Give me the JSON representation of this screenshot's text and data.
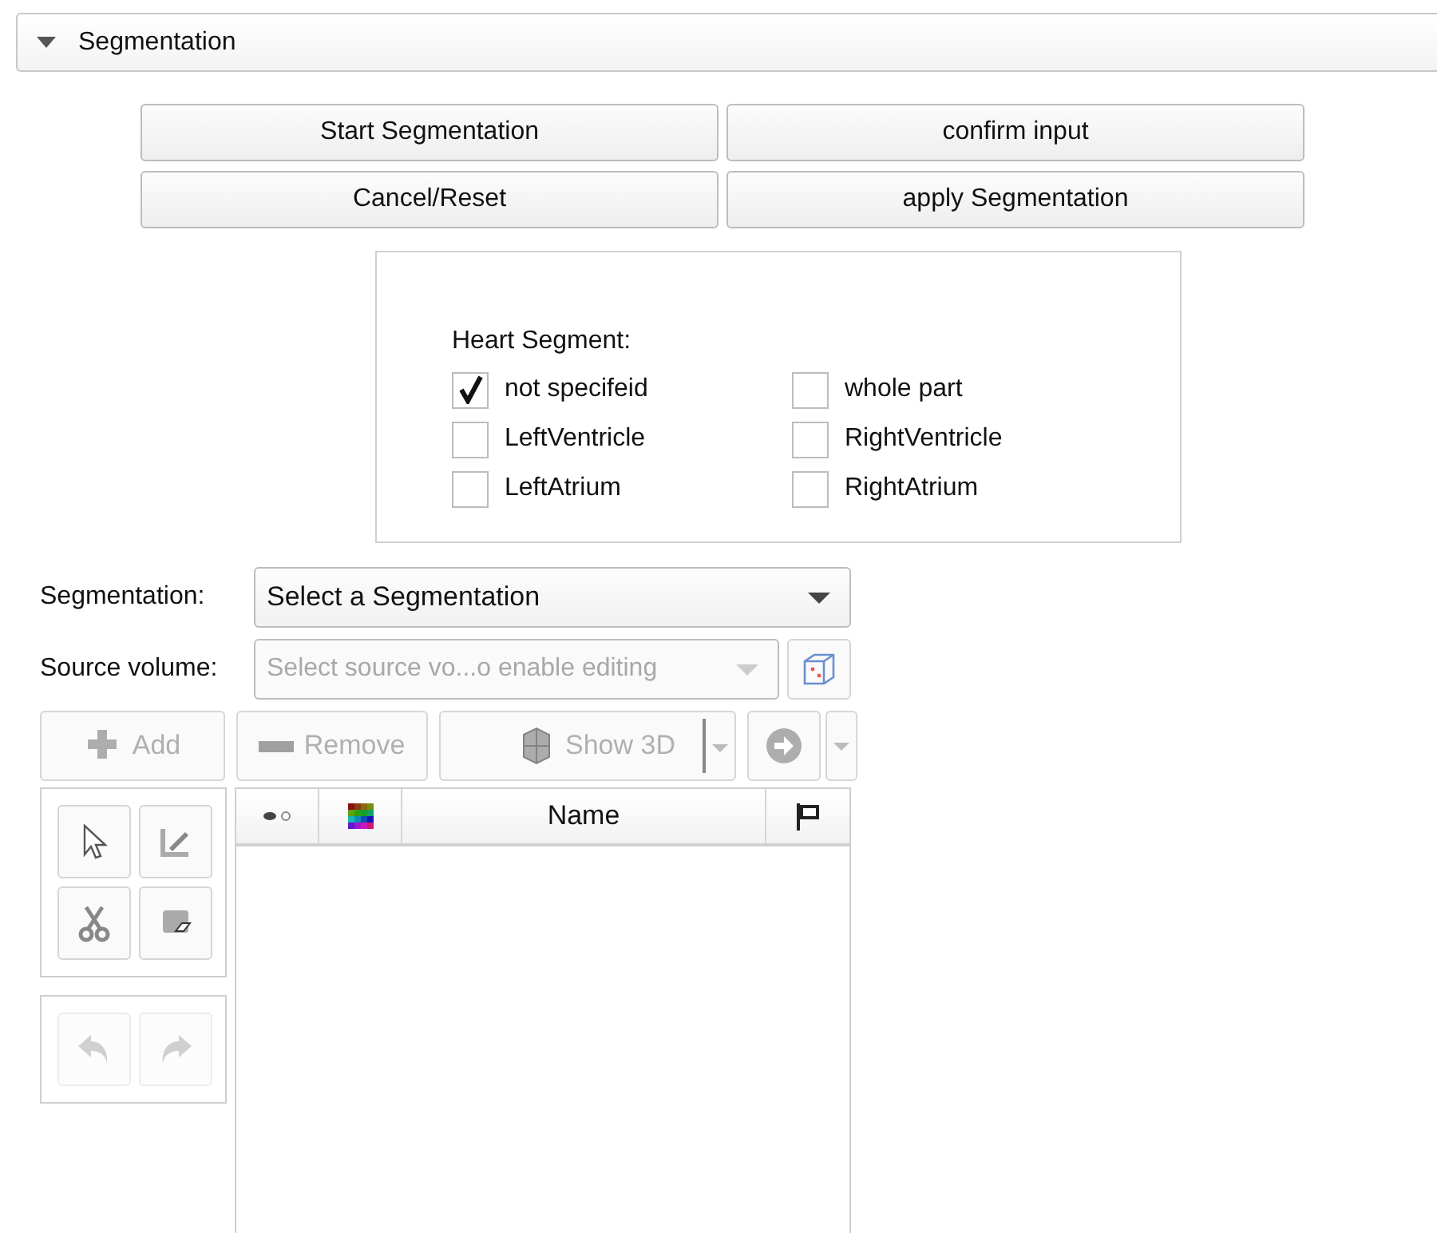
{
  "section": {
    "title": "Segmentation",
    "expanded": true
  },
  "action_buttons": [
    "Start Segmentation",
    "confirm input",
    "Cancel/Reset",
    "apply Segmentation"
  ],
  "heart_segment": {
    "label": "Heart Segment:",
    "options": [
      {
        "label": "not specifeid",
        "checked": true
      },
      {
        "label": "whole part",
        "checked": false
      },
      {
        "label": "LeftVentricle",
        "checked": false
      },
      {
        "label": "RightVentricle",
        "checked": false
      },
      {
        "label": "LeftAtrium",
        "checked": false
      },
      {
        "label": "RightAtrium",
        "checked": false
      }
    ]
  },
  "segmentation_selector": {
    "label": "Segmentation:",
    "value": "Select a Segmentation"
  },
  "source_volume": {
    "label": "Source volume:",
    "placeholder": "Select source vo...o enable editing",
    "disabled": true
  },
  "toolbar": [
    {
      "kind": "add",
      "label": "Add",
      "disabled": true
    },
    {
      "kind": "remove",
      "label": "Remove",
      "disabled": true
    },
    {
      "kind": "show3d",
      "label": "Show 3D",
      "disabled": true
    },
    {
      "kind": "next",
      "disabled": true
    }
  ],
  "undo_redo": [
    {
      "kind": "undo",
      "disabled": true
    },
    {
      "kind": "redo",
      "disabled": true
    }
  ],
  "table": {
    "columns": [
      {
        "kind": "visibility"
      },
      {
        "kind": "color"
      },
      {
        "kind": "text",
        "label": "Name"
      },
      {
        "kind": "status"
      }
    ]
  }
}
